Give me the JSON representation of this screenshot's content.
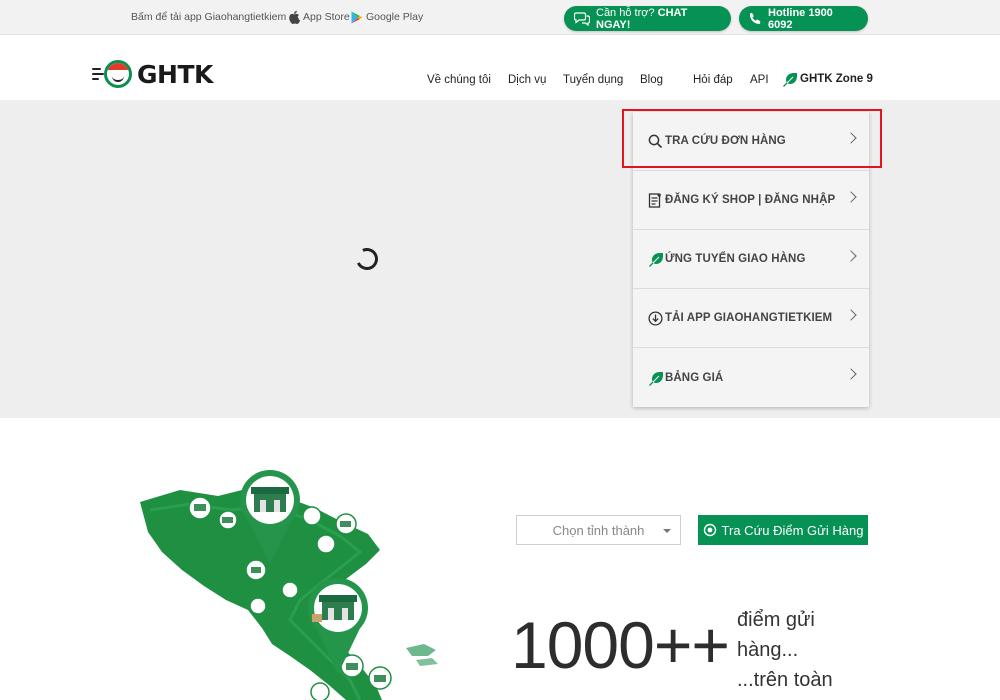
{
  "topbar": {
    "promo_text": "Bấm để tải app Giaohangtietkiem :",
    "app_store": "App Store",
    "google_play": "Google Play",
    "chat": {
      "prefix": "Cần hỗ trợ? ",
      "emphasis": "CHAT NGAY!"
    },
    "hotline": "Hotline 1900 6092"
  },
  "header": {
    "logo_text": "GHTK",
    "nav": [
      {
        "label": "Về chúng tôi"
      },
      {
        "label": "Dịch vụ"
      },
      {
        "label": "Tuyển dụng"
      },
      {
        "label": "Blog"
      },
      {
        "label": "Hỏi đáp"
      },
      {
        "label": "API"
      },
      {
        "label": "GHTK Zone 9"
      }
    ]
  },
  "quick_menu": [
    {
      "label": "TRA CỨU ĐƠN HÀNG",
      "icon": "search-icon"
    },
    {
      "label": "ĐĂNG KÝ SHOP | ĐĂNG NHẬP",
      "icon": "document-icon"
    },
    {
      "label": "ỨNG TUYỂN GIAO HÀNG",
      "icon": "leaf-icon"
    },
    {
      "label": "TẢI APP GIAOHANGTIETKIEM",
      "icon": "download-icon"
    },
    {
      "label": "BẢNG GIÁ",
      "icon": "leaf-icon"
    }
  ],
  "lookup": {
    "province_placeholder": "Chọn tỉnh thành",
    "button_label": "Tra Cứu Điểm Gửi Hàng"
  },
  "stats": {
    "number": "1000++",
    "caption_lines": [
      "điểm gửi",
      "hàng...",
      "...trên toàn"
    ]
  },
  "colors": {
    "brand_green": "#069255",
    "highlight_red": "#e0161c",
    "hero_bg": "#eeeeee"
  }
}
